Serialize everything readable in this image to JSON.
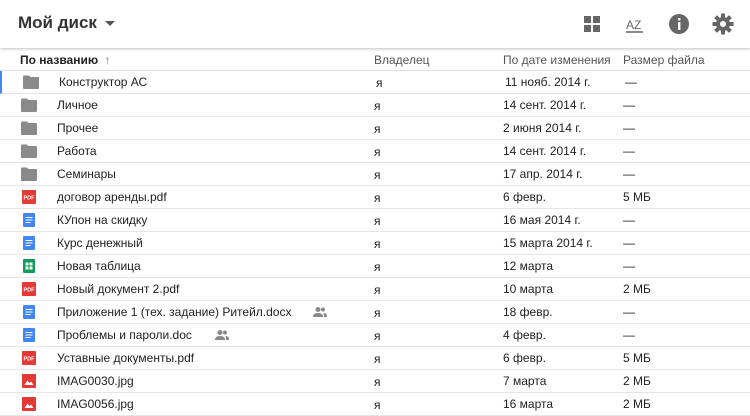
{
  "toolbar": {
    "title": "Мой диск",
    "icons": [
      "grid-view-icon",
      "sort-az-icon",
      "info-icon",
      "settings-gear-icon"
    ],
    "sort_icon_text": "AZ"
  },
  "columns": {
    "name": "По названию",
    "sort_arrow": "↑",
    "owner": "Владелец",
    "modified": "По дате изменения",
    "size": "Размер файла"
  },
  "colors": {
    "folder": "#8a8a8a",
    "pdf": "#e53935",
    "doc": "#4285f4",
    "sheet": "#0f9d58",
    "image": "#e53935",
    "selection": "#4285f4"
  },
  "files": [
    {
      "icon": "folder-icon",
      "name": "Конструктор АС",
      "owner": "я",
      "modified": "11 нояб. 2014 г.",
      "size": "—",
      "shared": false
    },
    {
      "icon": "folder-icon",
      "name": "Личное",
      "owner": "я",
      "modified": "14 сент. 2014 г.",
      "size": "—",
      "shared": false
    },
    {
      "icon": "folder-icon",
      "name": "Прочее",
      "owner": "я",
      "modified": "2 июня 2014 г.",
      "size": "—",
      "shared": false
    },
    {
      "icon": "folder-icon",
      "name": "Работа",
      "owner": "я",
      "modified": "14 сент. 2014 г.",
      "size": "—",
      "shared": false
    },
    {
      "icon": "folder-icon",
      "name": "Семинары",
      "owner": "я",
      "modified": "17 апр. 2014 г.",
      "size": "—",
      "shared": false
    },
    {
      "icon": "pdf-icon",
      "name": "договор аренды.pdf",
      "owner": "я",
      "modified": "6 февр.",
      "size": "5 МБ",
      "shared": false
    },
    {
      "icon": "doc-icon",
      "name": "КУпон на скидку",
      "owner": "я",
      "modified": "16 мая 2014 г.",
      "size": "—",
      "shared": false
    },
    {
      "icon": "doc-icon",
      "name": "Курс денежный",
      "owner": "я",
      "modified": "15 марта 2014 г.",
      "size": "—",
      "shared": false
    },
    {
      "icon": "sheet-icon",
      "name": "Новая таблица",
      "owner": "я",
      "modified": "12 марта",
      "size": "—",
      "shared": false
    },
    {
      "icon": "pdf-icon",
      "name": "Новый документ 2.pdf",
      "owner": "я",
      "modified": "10 марта",
      "size": "2 МБ",
      "shared": false
    },
    {
      "icon": "doc-icon",
      "name": "Приложение 1 (тех. задание) Ритейл.docx",
      "owner": "я",
      "modified": "18 февр.",
      "size": "—",
      "shared": true
    },
    {
      "icon": "doc-icon",
      "name": "Проблемы и пароли.doc",
      "owner": "я",
      "modified": "4 февр.",
      "size": "—",
      "shared": true
    },
    {
      "icon": "pdf-icon",
      "name": "Уставные документы.pdf",
      "owner": "я",
      "modified": "6 февр.",
      "size": "5 МБ",
      "shared": false
    },
    {
      "icon": "image-icon",
      "name": "IMAG0030.jpg",
      "owner": "я",
      "modified": "7 марта",
      "size": "2 МБ",
      "shared": false
    },
    {
      "icon": "image-icon",
      "name": "IMAG0056.jpg",
      "owner": "я",
      "modified": "16 марта",
      "size": "2 МБ",
      "shared": false
    }
  ]
}
